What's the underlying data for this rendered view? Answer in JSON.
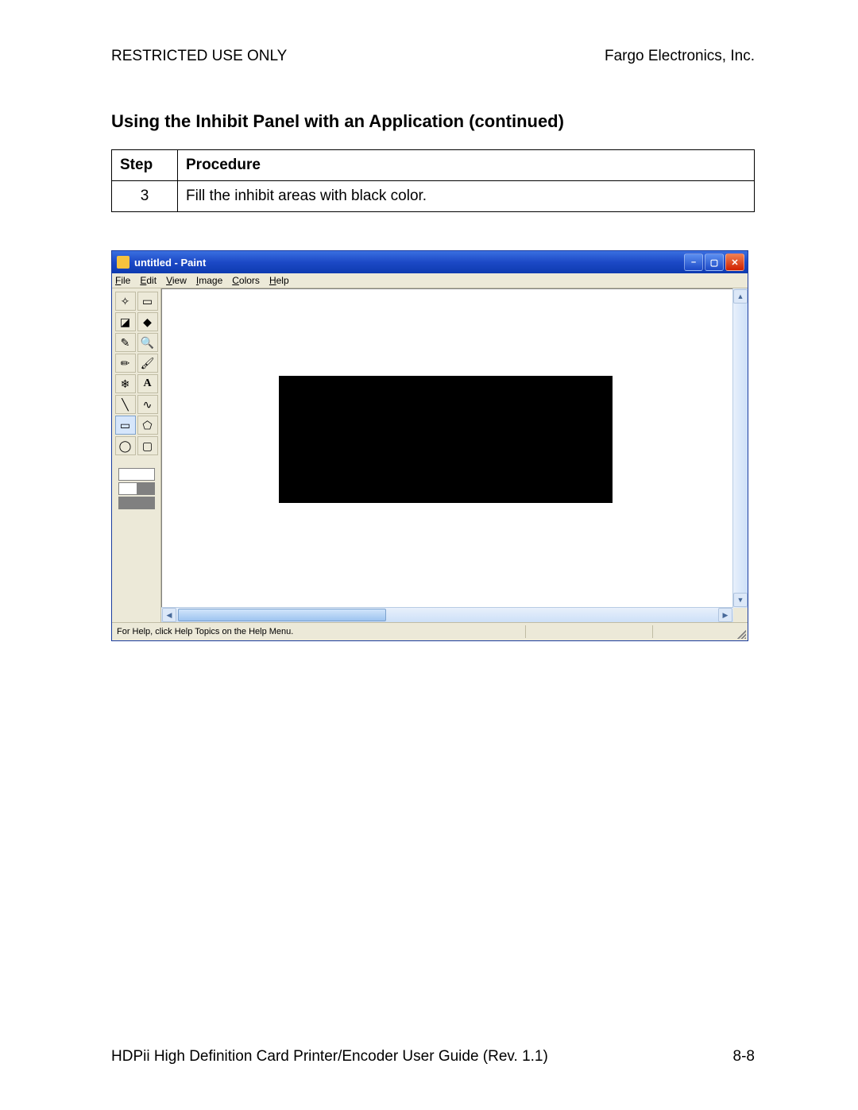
{
  "header": {
    "left": "RESTRICTED USE ONLY",
    "right": "Fargo Electronics, Inc."
  },
  "section_title": "Using the Inhibit Panel with an Application (continued)",
  "table": {
    "headers": {
      "step": "Step",
      "procedure": "Procedure"
    },
    "rows": [
      {
        "step": "3",
        "procedure": "Fill the inhibit areas with black color."
      }
    ]
  },
  "paint": {
    "title": "untitled - Paint",
    "menus": {
      "file": "File",
      "edit": "Edit",
      "view": "View",
      "image": "Image",
      "colors": "Colors",
      "help": "Help"
    },
    "statusbar": "For Help, click Help Topics on the Help Menu.",
    "tools": {
      "free_select": "✧",
      "rect_select": "▭",
      "eraser": "◪",
      "fill": "◆",
      "picker": "✎",
      "magnify": "🔍",
      "pencil": "✏",
      "brush": "🖌",
      "airbrush": "❄",
      "text": "A",
      "line": "╲",
      "curve": "∿",
      "rectangle": "▭",
      "polygon": "⬠",
      "ellipse": "◯",
      "round_rect": "▢"
    }
  },
  "footer": {
    "left": "HDPii High Definition Card Printer/Encoder User Guide (Rev. 1.1)",
    "right": "8-8"
  }
}
